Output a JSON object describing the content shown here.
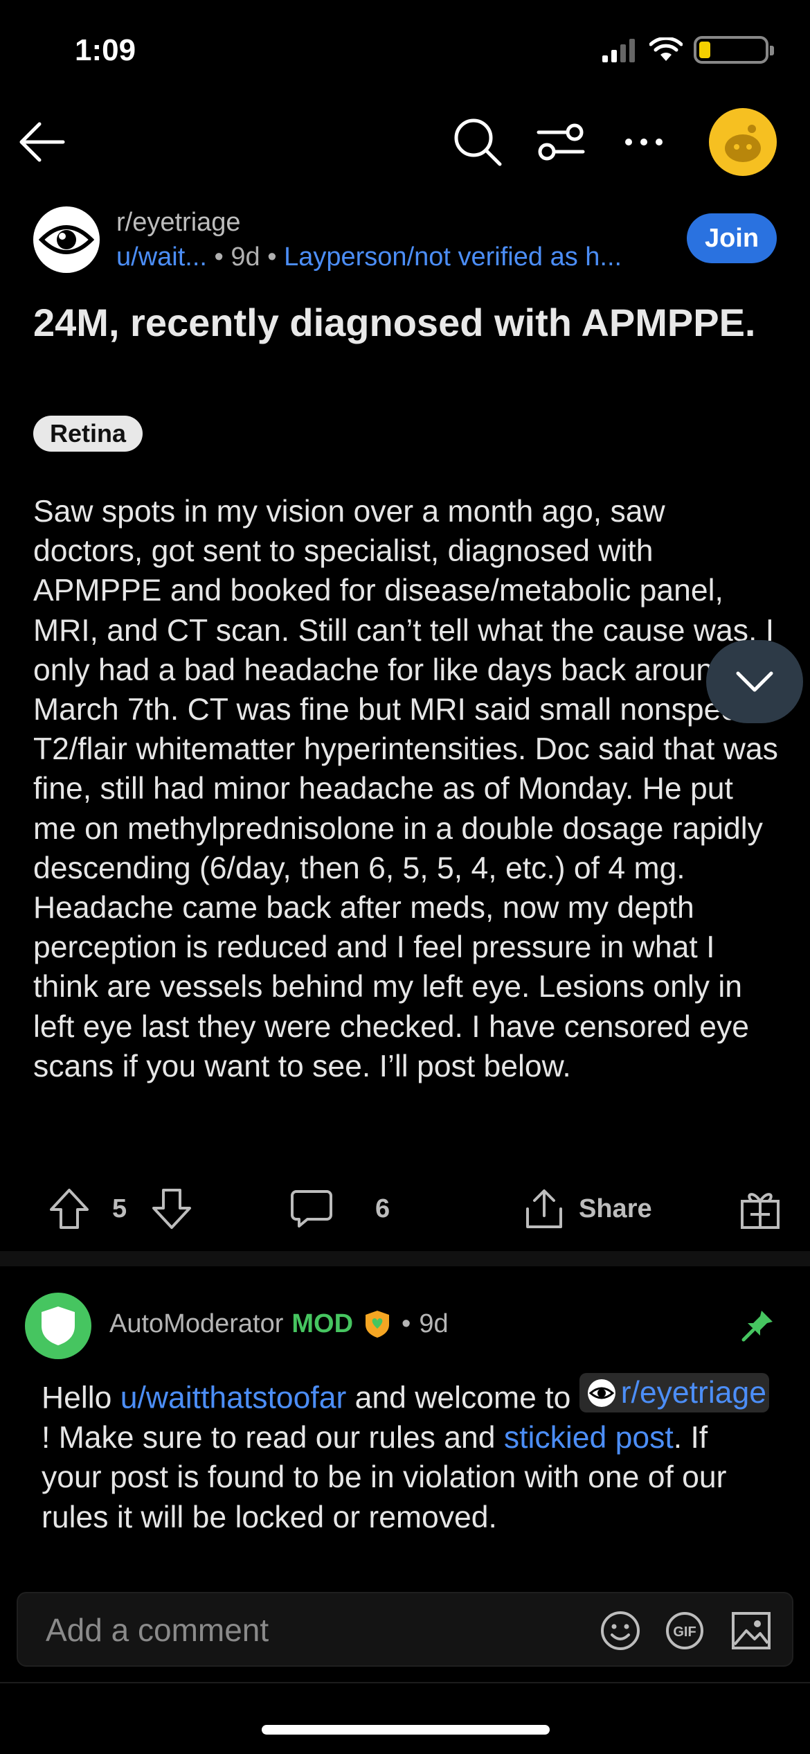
{
  "status_bar": {
    "time": "1:09"
  },
  "post": {
    "subreddit": "r/eyetriage",
    "author": "u/wait...",
    "age": "9d",
    "author_flair": "Layperson/not verified as h...",
    "join_label": "Join",
    "title": "24M, recently diagnosed with APMPPE.",
    "flair": "Retina",
    "body": "Saw spots in my vision over a month ago, saw doctors, got sent to specialist, diagnosed with APMPPE and booked for disease/metabolic panel, MRI, and CT scan. Still can’t tell what the cause was, I only had a bad headache for like days back around March 7th. CT was fine but MRI said small nonspecific T2/flair whitematter hyperintensities. Doc said that was fine, still had minor headache as of Monday. He put me on methylprednisolone in a double dosage rapidly descending (6/day, then 6, 5, 5, 4, etc.) of 4 mg. Headache came back after meds, now my depth perception is reduced and I feel pressure in what I think are vessels behind my left eye. Lesions only in left eye last they were checked. I have censored eye scans if you want to see. I’ll post below.",
    "votes": "5",
    "comments": "6",
    "share_label": "Share"
  },
  "comment": {
    "author": "AutoModerator",
    "mod_label": "MOD",
    "age": "9d",
    "text_1": "Hello ",
    "user_link": "u/waitthatstoofar",
    "text_2": " and welcome to ",
    "sub_link": "r/eyetriage",
    "text_3": "! Make sure to read our rules and ",
    "sticky_link": "stickied post",
    "text_4": ". If your post is found to be in violation with one of our rules it will be locked or removed."
  },
  "composer": {
    "placeholder": "Add a comment"
  },
  "colors": {
    "accent_blue": "#4c8ef7",
    "join_blue": "#2a72e0",
    "mod_green": "#46c560",
    "avatar_yellow": "#f6c021"
  }
}
